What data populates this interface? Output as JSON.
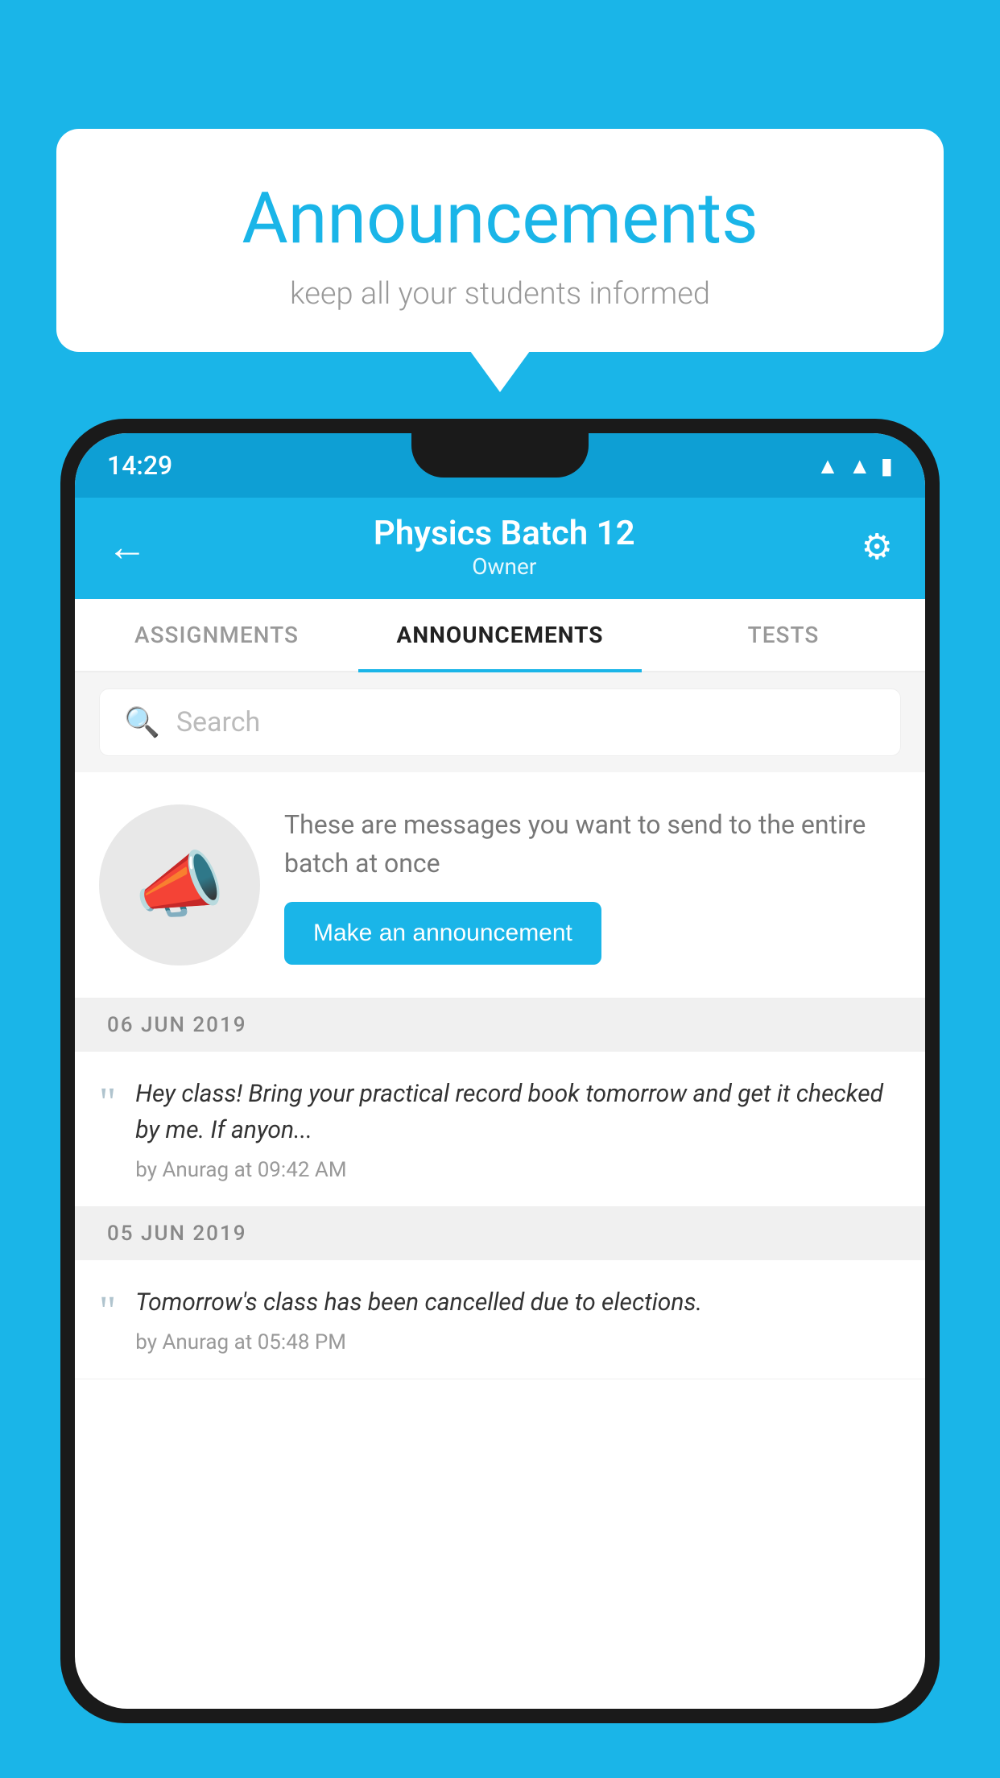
{
  "bubble": {
    "title": "Announcements",
    "subtitle": "keep all your students informed"
  },
  "statusBar": {
    "time": "14:29",
    "icons": [
      "wifi",
      "signal",
      "battery"
    ]
  },
  "header": {
    "title": "Physics Batch 12",
    "subtitle": "Owner"
  },
  "tabs": [
    {
      "label": "ASSIGNMENTS",
      "active": false
    },
    {
      "label": "ANNOUNCEMENTS",
      "active": true
    },
    {
      "label": "TESTS",
      "active": false
    }
  ],
  "search": {
    "placeholder": "Search"
  },
  "promo": {
    "text": "These are messages you want to send to the entire batch at once",
    "buttonLabel": "Make an announcement"
  },
  "dates": [
    {
      "label": "06  JUN  2019",
      "announcements": [
        {
          "text": "Hey class! Bring your practical record book tomorrow and get it checked by me. If anyon...",
          "meta": "by Anurag at 09:42 AM"
        }
      ]
    },
    {
      "label": "05  JUN  2019",
      "announcements": [
        {
          "text": "Tomorrow's class has been cancelled due to elections.",
          "meta": "by Anurag at 05:48 PM"
        }
      ]
    }
  ]
}
